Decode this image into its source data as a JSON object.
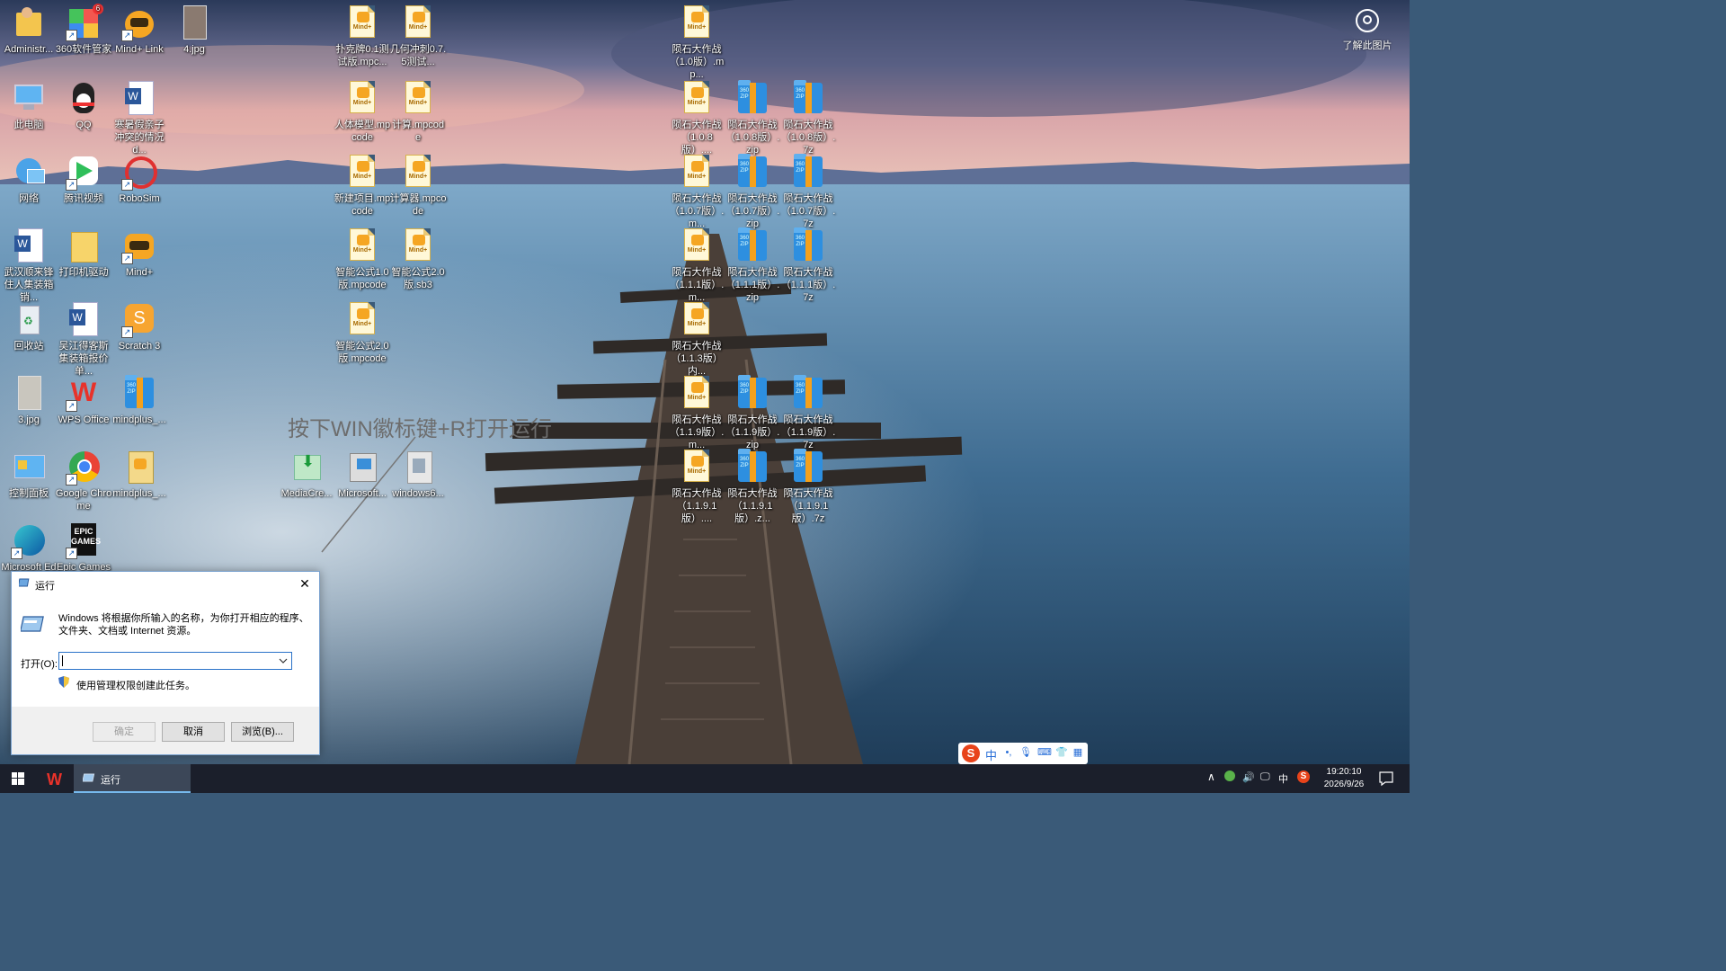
{
  "desktop": {
    "icons": [
      {
        "label": "Administr...",
        "type": "user-folder"
      },
      {
        "label": "360软件管家",
        "type": "app-360",
        "badge": "6"
      },
      {
        "label": "Mind+ Link",
        "type": "app-mindplus-link"
      },
      {
        "label": "4.jpg",
        "type": "image"
      },
      {
        "label": "此电脑",
        "type": "this-pc"
      },
      {
        "label": "QQ",
        "type": "app-qq"
      },
      {
        "label": "寒暑假亲子冲突的情况d...",
        "type": "word"
      },
      {
        "label": "网络",
        "type": "network"
      },
      {
        "label": "腾讯视频",
        "type": "app-tencent-video"
      },
      {
        "label": "RoboSim",
        "type": "app-robosim"
      },
      {
        "label": "武汉顺来锋住人集装箱销...",
        "type": "word"
      },
      {
        "label": "打印机驱动",
        "type": "folder"
      },
      {
        "label": "Mind+",
        "type": "app-mindplus"
      },
      {
        "label": "回收站",
        "type": "recycle-bin"
      },
      {
        "label": "吴江得客斯集装箱报价单...",
        "type": "word"
      },
      {
        "label": "Scratch 3",
        "type": "app-scratch"
      },
      {
        "label": "3.jpg",
        "type": "image"
      },
      {
        "label": "WPS Office",
        "type": "app-wps"
      },
      {
        "label": "mindplus_...",
        "type": "zip"
      },
      {
        "label": "控制面板",
        "type": "control-panel"
      },
      {
        "label": "Google Chrome",
        "type": "app-chrome"
      },
      {
        "label": "mindplus_...",
        "type": "installer"
      },
      {
        "label": "Microsoft Edge",
        "type": "app-edge"
      },
      {
        "label": "Epic Games",
        "type": "app-epic"
      },
      {
        "label": "扑克牌0.1测试版.mpc...",
        "type": "mindfile"
      },
      {
        "label": "几何冲刺0.7.5测试...",
        "type": "mindfile"
      },
      {
        "label": "人体模型.mpcode",
        "type": "mindfile"
      },
      {
        "label": "计算.mpcode",
        "type": "mindfile"
      },
      {
        "label": "新建项目.mpcode",
        "type": "mindfile"
      },
      {
        "label": "计算器.mpcode",
        "type": "mindfile"
      },
      {
        "label": "智能公式1.0版.mpcode",
        "type": "mindfile"
      },
      {
        "label": "智能公式2.0版.sb3",
        "type": "mindfile"
      },
      {
        "label": "智能公式2.0版.mpcode",
        "type": "mindfile"
      },
      {
        "label": "MediaCre...",
        "type": "media-creation"
      },
      {
        "label": "Microsoft...",
        "type": "ms-installer"
      },
      {
        "label": "windows6...",
        "type": "windows-file"
      },
      {
        "label": "陨石大作战（1.0版）.mp...",
        "type": "mindfile"
      },
      {
        "label": "陨石大作战（1.0.8版）....",
        "type": "mindfile"
      },
      {
        "label": "陨石大作战（1.0.8版）.zip",
        "type": "zip"
      },
      {
        "label": "陨石大作战（1.0.8版）.7z",
        "type": "zip"
      },
      {
        "label": "陨石大作战（1.0.7版）.m...",
        "type": "mindfile"
      },
      {
        "label": "陨石大作战（1.0.7版）.zip",
        "type": "zip"
      },
      {
        "label": "陨石大作战（1.0.7版）.7z",
        "type": "zip"
      },
      {
        "label": "陨石大作战（1.1.1版）.m...",
        "type": "mindfile"
      },
      {
        "label": "陨石大作战（1.1.1版）.zip",
        "type": "zip"
      },
      {
        "label": "陨石大作战（1.1.1版）.7z",
        "type": "zip"
      },
      {
        "label": "陨石大作战（1.1.3版）内...",
        "type": "mindfile"
      },
      {
        "label": "陨石大作战（1.1.9版）.m...",
        "type": "mindfile"
      },
      {
        "label": "陨石大作战（1.1.9版）.zip",
        "type": "zip"
      },
      {
        "label": "陨石大作战（1.1.9版）.7z",
        "type": "zip"
      },
      {
        "label": "陨石大作战（1.1.9.1版）....",
        "type": "mindfile"
      },
      {
        "label": "陨石大作战（1.1.9.1版）.z...",
        "type": "zip"
      },
      {
        "label": "陨石大作战（1.1.9.1版）.7z",
        "type": "zip"
      }
    ]
  },
  "annotation": "按下WIN徽标键+R打开运行",
  "learn_more": "了解此图片",
  "run_dialog": {
    "title": "运行",
    "description": "Windows 将根据你所输入的名称，为你打开相应的程序、文件夹、文档或 Internet 资源。",
    "open_label": "打开(O):",
    "open_value": "",
    "admin_text": "使用管理权限创建此任务。",
    "ok": "确定",
    "cancel": "取消",
    "browse": "浏览(B)..."
  },
  "ime": {
    "mode": "中"
  },
  "taskbar": {
    "active_task": "运行",
    "tray_lang": "中",
    "time": "19:20:10",
    "date": "2026/9/26"
  },
  "colors": {
    "taskbar": "#1b1f2b",
    "accent": "#76b9ed",
    "ime_brand": "#e8431a"
  }
}
